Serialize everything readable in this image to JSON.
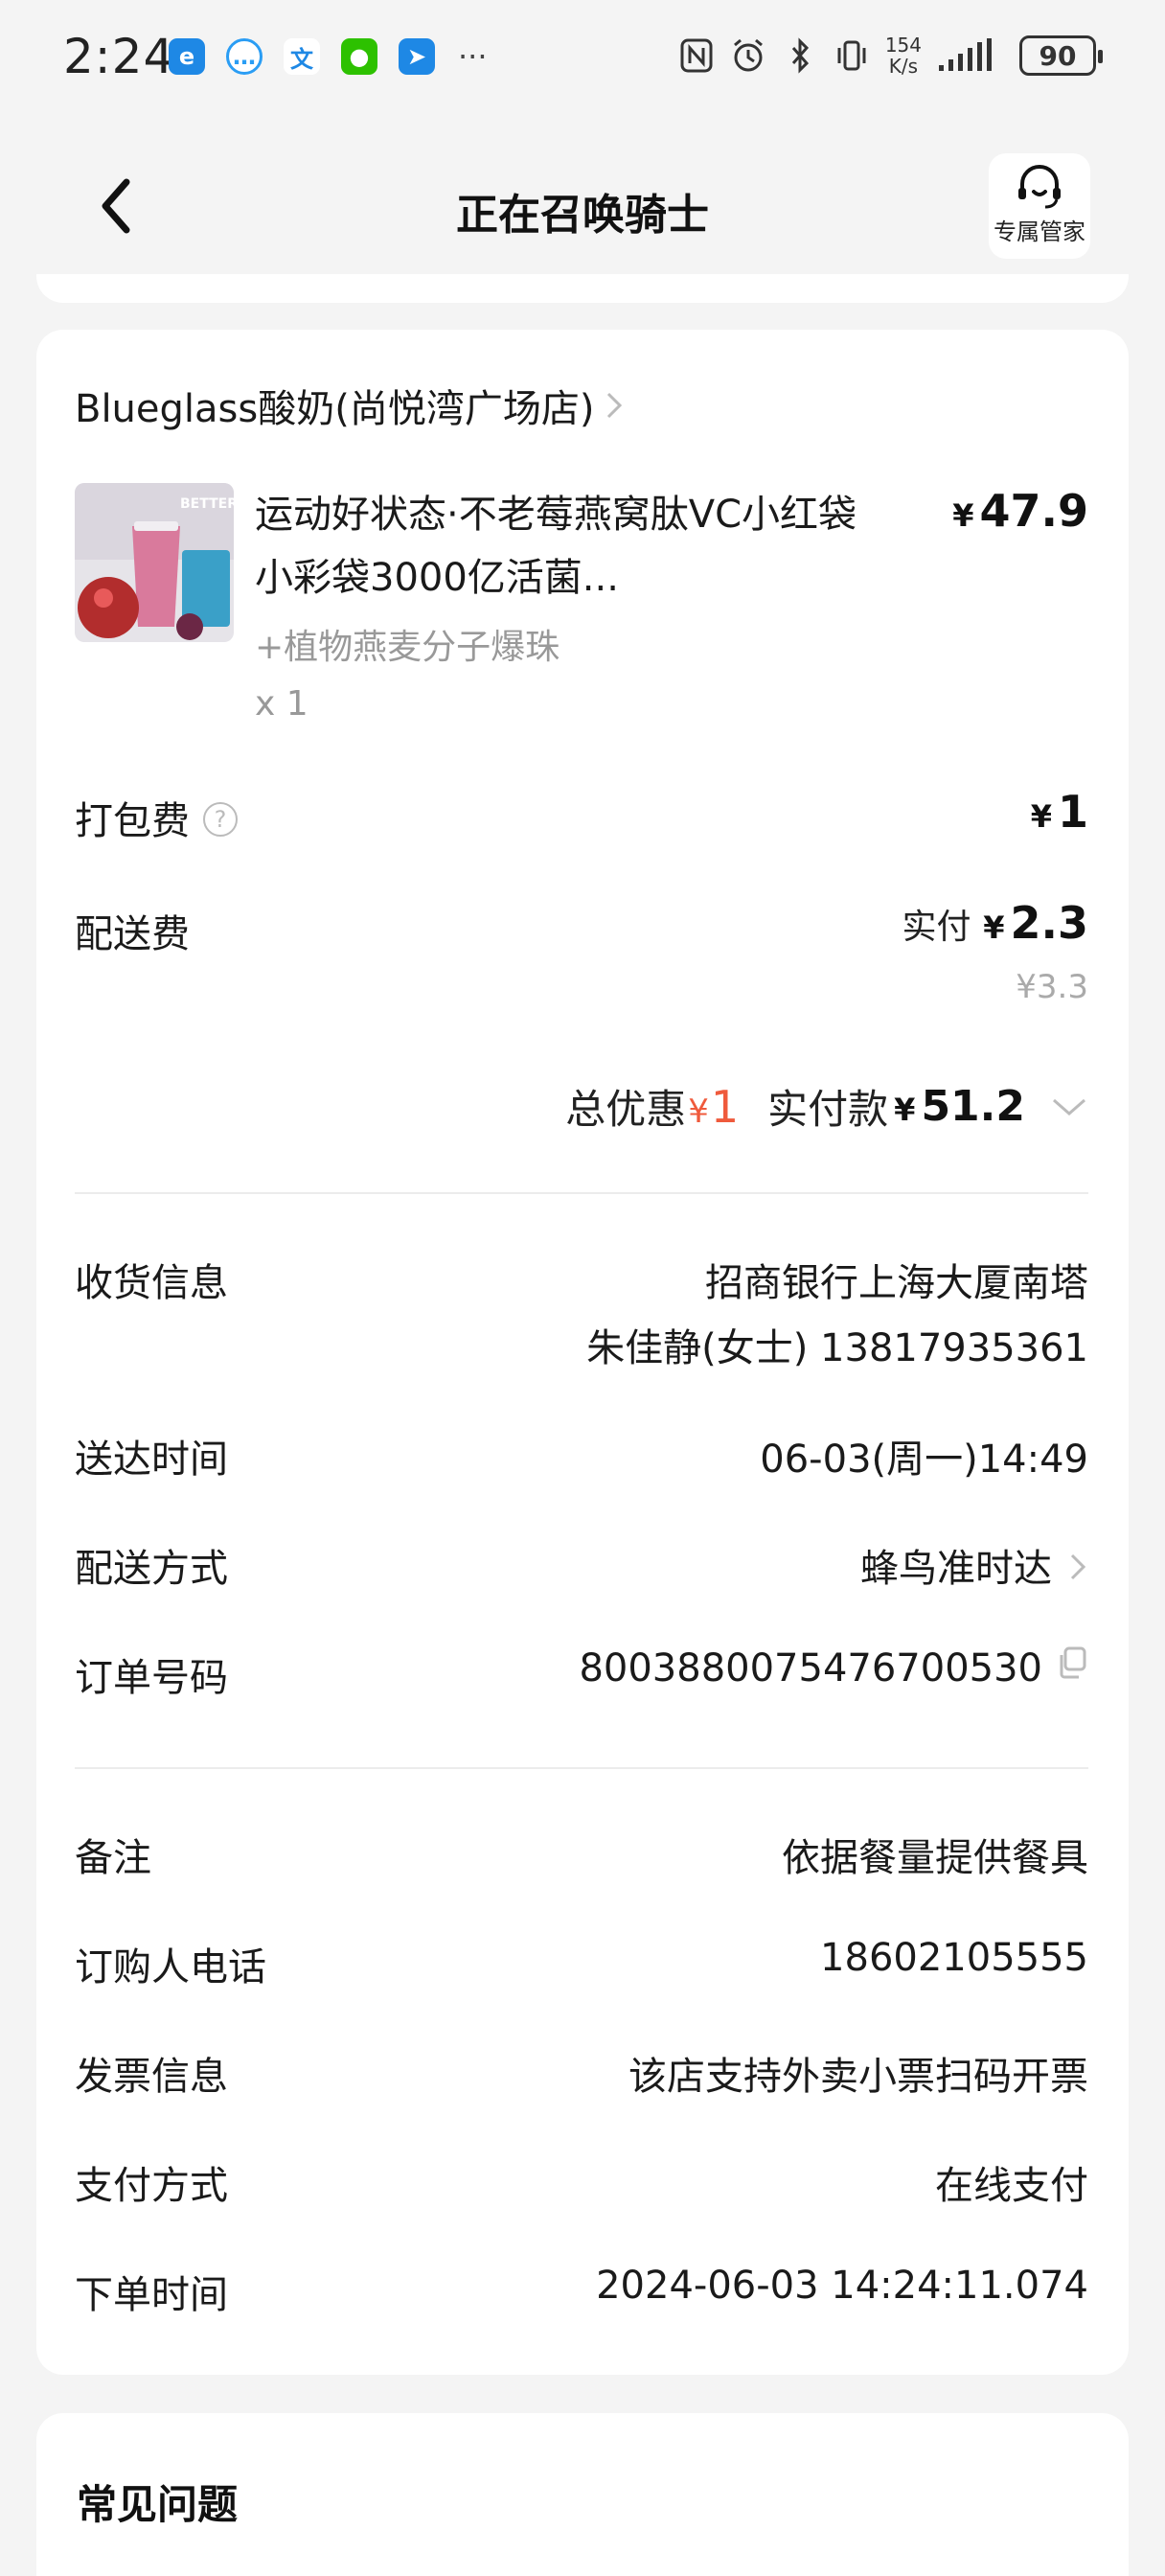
{
  "status_bar": {
    "time": "2:24",
    "more": "···",
    "net_speed_value": "154",
    "net_speed_unit": "K/s",
    "battery": "90",
    "apps": [
      "browser-icon",
      "chat-bubble-icon",
      "translate-icon",
      "wechat-icon",
      "send-icon"
    ]
  },
  "header": {
    "title": "正在召唤骑士",
    "butler_label": "专属管家"
  },
  "order": {
    "shop_name": "Blueglass酸奶(尚悦湾广场店)",
    "product": {
      "name": "运动好状态·不老莓燕窝肽VC小红袋小彩袋3000亿活菌...",
      "addon": "+植物燕麦分子爆珠",
      "qty": "x 1",
      "price_symbol": "¥",
      "price": "47.9"
    },
    "packing_fee": {
      "label": "打包费",
      "symbol": "¥",
      "value": "1"
    },
    "delivery_fee": {
      "label": "配送费",
      "paid_prefix": "实付",
      "symbol": "¥",
      "paid": "2.3",
      "original": "¥3.3"
    },
    "summary": {
      "discount_label": "总优惠",
      "discount_symbol": "¥",
      "discount_value": "1",
      "paid_label": "实付款",
      "paid_symbol": "¥",
      "paid_value": "51.2"
    }
  },
  "info": {
    "receiver_label": "收货信息",
    "receiver_address": "招商银行上海大厦南塔",
    "receiver_contact": "朱佳静(女士) 13817935361",
    "delivery_time_label": "送达时间",
    "delivery_time": "06-03(周一)14:49",
    "delivery_method_label": "配送方式",
    "delivery_method": "蜂鸟准时达",
    "order_no_label": "订单号码",
    "order_no": "8003880075476700530"
  },
  "extra": {
    "note_label": "备注",
    "note": "依据餐量提供餐具",
    "phone_label": "订购人电话",
    "phone": "18602105555",
    "invoice_label": "发票信息",
    "invoice": "该店支持外卖小票扫码开票",
    "payment_label": "支付方式",
    "payment": "在线支付",
    "order_time_label": "下单时间",
    "order_time": "2024-06-03 14:24:11.074"
  },
  "faq": {
    "title": "常见问题"
  },
  "colors": {
    "discount": "#ef5a3c",
    "background": "#f4f4f4",
    "card": "#ffffff"
  }
}
